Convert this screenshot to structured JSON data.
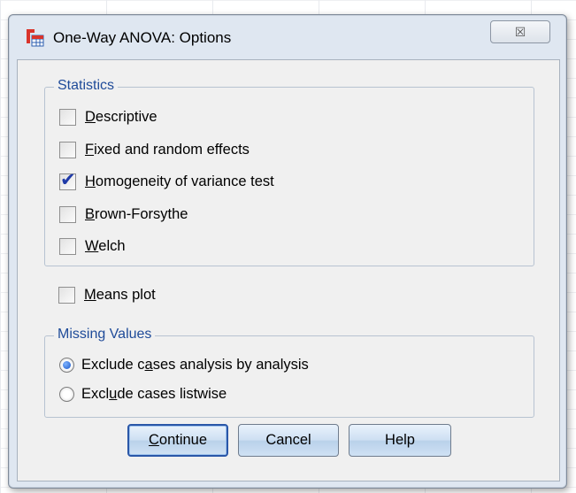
{
  "window": {
    "title": "One-Way ANOVA: Options",
    "close_glyph": "☒"
  },
  "statistics": {
    "legend": "Statistics",
    "items": [
      {
        "pre": "",
        "ul": "D",
        "post": "escriptive",
        "checked": false
      },
      {
        "pre": "",
        "ul": "F",
        "post": "ixed and random effects",
        "checked": false
      },
      {
        "pre": "",
        "ul": "H",
        "post": "omogeneity of variance test",
        "checked": true
      },
      {
        "pre": "",
        "ul": "B",
        "post": "rown-Forsythe",
        "checked": false
      },
      {
        "pre": "",
        "ul": "W",
        "post": "elch",
        "checked": false
      }
    ]
  },
  "means_plot": {
    "pre": "",
    "ul": "M",
    "post": "eans plot",
    "checked": false
  },
  "missing_values": {
    "legend": "Missing Values",
    "options": [
      {
        "pre": "Exclude c",
        "ul": "a",
        "post": "ses analysis by analysis",
        "selected": true
      },
      {
        "pre": "Excl",
        "ul": "u",
        "post": "de cases listwise",
        "selected": false
      }
    ]
  },
  "buttons": {
    "continue": {
      "ul": "C",
      "post": "ontinue"
    },
    "cancel": "Cancel",
    "help": "Help"
  },
  "colors": {
    "accent": "#1f4b99",
    "dialog_bg": "#dfe7f1",
    "client_bg": "#f0f0f0"
  }
}
